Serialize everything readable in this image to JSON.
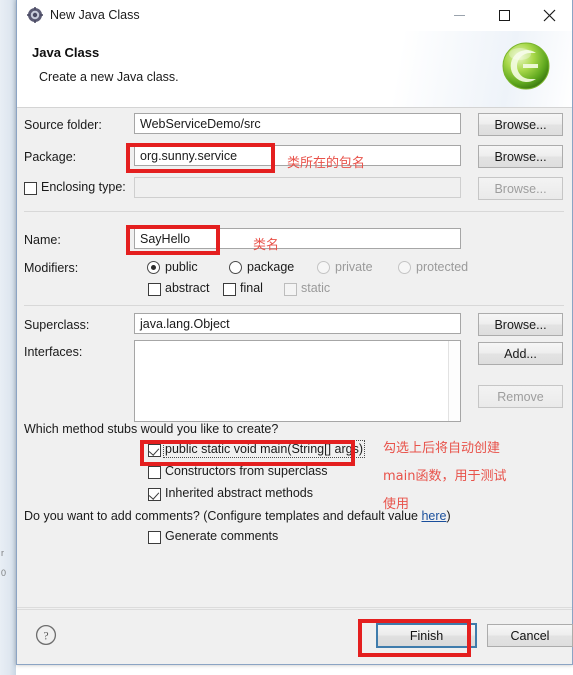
{
  "window": {
    "title": "New Java Class",
    "icon": "java-class-icon",
    "controls": {
      "minimize": "minimize-icon",
      "maximize": "maximize-icon",
      "close": "close-icon"
    }
  },
  "header": {
    "title": "Java Class",
    "description": "Create a new Java class.",
    "logo": "eclipse-logo-icon"
  },
  "form": {
    "source_folder": {
      "label": "Source folder:",
      "value": "WebServiceDemo/src",
      "browse": "Browse...",
      "enabled": true
    },
    "package": {
      "label": "Package:",
      "value": "org.sunny.service",
      "placeholder": "",
      "browse": "Browse...",
      "enabled": true
    },
    "enclosing_type": {
      "label": "Enclosing type:",
      "checked": false,
      "value": "",
      "browse": "Browse...",
      "enabled": false
    },
    "name": {
      "label": "Name:",
      "value": "SayHello",
      "placeholder": ""
    },
    "modifiers": {
      "label": "Modifiers:",
      "access": [
        {
          "label": "public",
          "selected": true,
          "enabled": true
        },
        {
          "label": "package",
          "selected": false,
          "enabled": true
        },
        {
          "label": "private",
          "selected": false,
          "enabled": false
        },
        {
          "label": "protected",
          "selected": false,
          "enabled": false
        }
      ],
      "flags": [
        {
          "label": "abstract",
          "checked": false,
          "enabled": true
        },
        {
          "label": "final",
          "checked": false,
          "enabled": true
        },
        {
          "label": "static",
          "checked": false,
          "enabled": false
        }
      ]
    },
    "superclass": {
      "label": "Superclass:",
      "value": "java.lang.Object",
      "browse": "Browse..."
    },
    "interfaces": {
      "label": "Interfaces:",
      "items": [],
      "add": "Add...",
      "remove": "Remove",
      "remove_enabled": false
    },
    "stubs": {
      "question": "Which method stubs would you like to create?",
      "options": [
        {
          "label": "public static void main(String[] args)",
          "checked": true,
          "focused": true
        },
        {
          "label": "Constructors from superclass",
          "checked": false,
          "focused": false
        },
        {
          "label": "Inherited abstract methods",
          "checked": true,
          "focused": false
        }
      ]
    },
    "comments": {
      "question_prefix": "Do you want to add comments? (Configure templates and default value ",
      "link": "here",
      "question_suffix": ")",
      "checkbox": {
        "label": "Generate comments",
        "checked": false
      }
    }
  },
  "footer": {
    "help": "help-icon",
    "finish": "Finish",
    "cancel": "Cancel"
  },
  "annotations": {
    "package_note": "类所在的包名",
    "name_note": "类名",
    "main_note_line1": "勾选上后将自动创建",
    "main_note_line2": "main函数，用于测试",
    "main_note_line3": "使用",
    "color": "#e8524a",
    "box_color": "#e41f1f"
  },
  "background": {
    "fragments": [
      "r",
      "0"
    ]
  }
}
